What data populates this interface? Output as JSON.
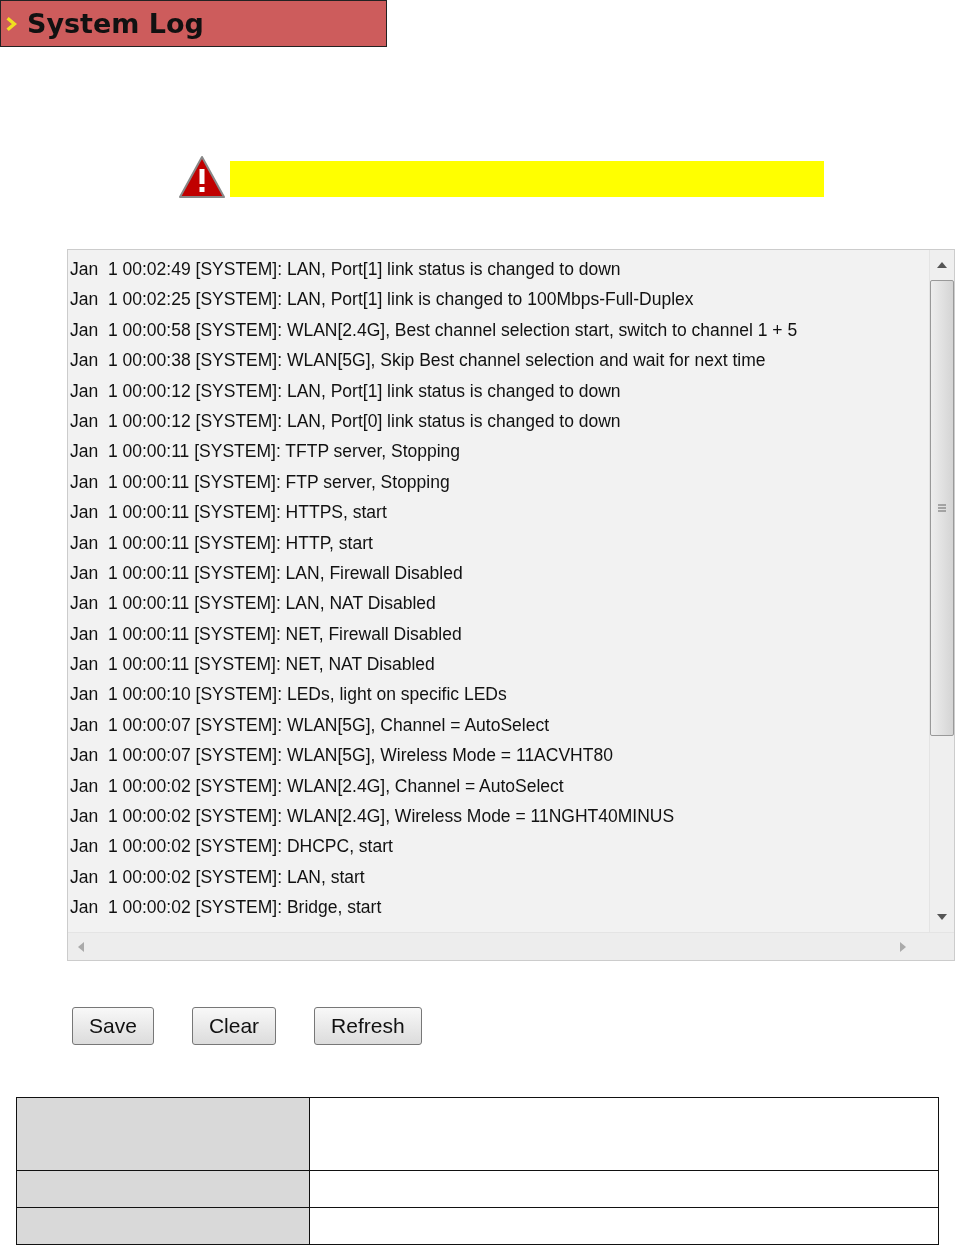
{
  "header": {
    "title": "System Log"
  },
  "log": {
    "lines": [
      "Jan  1 00:02:49 [SYSTEM]: LAN, Port[1] link status is changed to down",
      "Jan  1 00:02:25 [SYSTEM]: LAN, Port[1] link is changed to 100Mbps-Full-Duplex",
      "Jan  1 00:00:58 [SYSTEM]: WLAN[2.4G], Best channel selection start, switch to channel 1 + 5",
      "Jan  1 00:00:38 [SYSTEM]: WLAN[5G], Skip Best channel selection and wait for next time",
      "Jan  1 00:00:12 [SYSTEM]: LAN, Port[1] link status is changed to down",
      "Jan  1 00:00:12 [SYSTEM]: LAN, Port[0] link status is changed to down",
      "Jan  1 00:00:11 [SYSTEM]: TFTP server, Stopping",
      "Jan  1 00:00:11 [SYSTEM]: FTP server, Stopping",
      "Jan  1 00:00:11 [SYSTEM]: HTTPS, start",
      "Jan  1 00:00:11 [SYSTEM]: HTTP, start",
      "Jan  1 00:00:11 [SYSTEM]: LAN, Firewall Disabled",
      "Jan  1 00:00:11 [SYSTEM]: LAN, NAT Disabled",
      "Jan  1 00:00:11 [SYSTEM]: NET, Firewall Disabled",
      "Jan  1 00:00:11 [SYSTEM]: NET, NAT Disabled",
      "Jan  1 00:00:10 [SYSTEM]: LEDs, light on specific LEDs",
      "Jan  1 00:00:07 [SYSTEM]: WLAN[5G], Channel = AutoSelect",
      "Jan  1 00:00:07 [SYSTEM]: WLAN[5G], Wireless Mode = 11ACVHT80",
      "Jan  1 00:00:02 [SYSTEM]: WLAN[2.4G], Channel = AutoSelect",
      "Jan  1 00:00:02 [SYSTEM]: WLAN[2.4G], Wireless Mode = 11NGHT40MINUS",
      "Jan  1 00:00:02 [SYSTEM]: DHCPC, start",
      "Jan  1 00:00:02 [SYSTEM]: LAN, start",
      "Jan  1 00:00:02 [SYSTEM]: Bridge, start"
    ]
  },
  "buttons": [
    "Save",
    "Clear",
    "Refresh"
  ],
  "table": {
    "rows": [
      {
        "kind": "tall"
      },
      {
        "kind": "short"
      },
      {
        "kind": "short"
      }
    ]
  }
}
